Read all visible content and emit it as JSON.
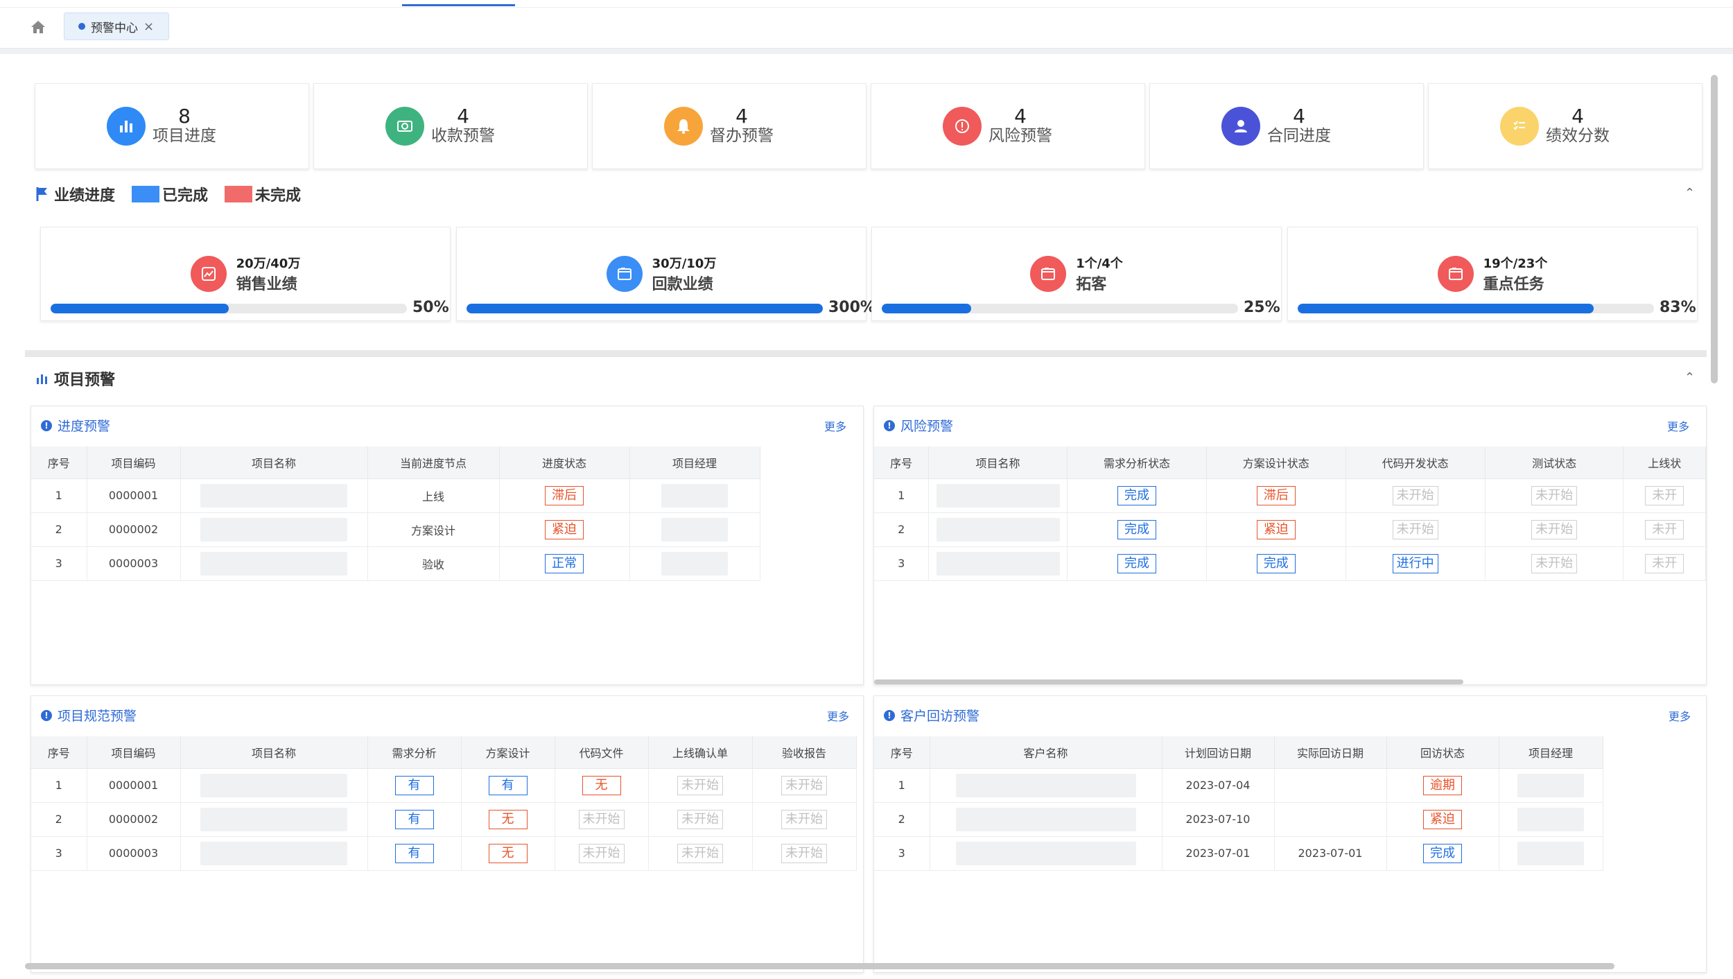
{
  "tabs": [
    {
      "label": "预警中心",
      "close": "×"
    }
  ],
  "stats": [
    {
      "num": "8",
      "label": "项目进度",
      "color": "#2f8af5",
      "icon": "bar-chart-icon"
    },
    {
      "num": "4",
      "label": "收款预警",
      "color": "#3fb37f",
      "icon": "money-icon"
    },
    {
      "num": "4",
      "label": "督办预警",
      "color": "#f7a53a",
      "icon": "bell-icon"
    },
    {
      "num": "4",
      "label": "风险预警",
      "color": "#f05a5a",
      "icon": "alert-icon"
    },
    {
      "num": "4",
      "label": "合同进度",
      "color": "#4a53d8",
      "icon": "user-icon"
    },
    {
      "num": "4",
      "label": "绩效分数",
      "color": "#fad46a",
      "icon": "checklist-icon"
    }
  ],
  "performance": {
    "title": "业绩进度",
    "legend": [
      {
        "label": "已完成",
        "color": "#3a8ef5"
      },
      {
        "label": "未完成",
        "color": "#f26b6b"
      }
    ],
    "collapse": "⌃",
    "cards": [
      {
        "value": "20万/40万",
        "label": "销售业绩",
        "pct": "50%",
        "fill": 0.5,
        "color": "#f05a5a"
      },
      {
        "value": "30万/10万",
        "label": "回款业绩",
        "pct": "300%",
        "fill": 1.0,
        "color": "#3a8ef5"
      },
      {
        "value": "1个/4个",
        "label": "拓客",
        "pct": "25%",
        "fill": 0.25,
        "color": "#f05a5a"
      },
      {
        "value": "19个/23个",
        "label": "重点任务",
        "pct": "83%",
        "fill": 0.83,
        "color": "#f05a5a"
      }
    ]
  },
  "project_warning": {
    "title": "项目预警",
    "collapse": "⌃"
  },
  "panels": {
    "progress": {
      "title": "进度预警",
      "more": "更多",
      "columns": [
        "序号",
        "项目编码",
        "项目名称",
        "当前进度节点",
        "进度状态",
        "项目经理"
      ],
      "rows": [
        {
          "no": "1",
          "code": "0000001",
          "node": "上线",
          "status": "滞后",
          "tone": "red"
        },
        {
          "no": "2",
          "code": "0000002",
          "node": "方案设计",
          "status": "紧迫",
          "tone": "red"
        },
        {
          "no": "3",
          "code": "0000003",
          "node": "验收",
          "status": "正常",
          "tone": "blue"
        }
      ]
    },
    "risk": {
      "title": "风险预警",
      "more": "更多",
      "columns": [
        "序号",
        "项目名称",
        "需求分析状态",
        "方案设计状态",
        "代码开发状态",
        "测试状态",
        "上线状"
      ],
      "rows": [
        {
          "no": "1",
          "cells": [
            [
              "完成",
              "blue"
            ],
            [
              "滞后",
              "red"
            ],
            [
              "未开始",
              "gray"
            ],
            [
              "未开始",
              "gray"
            ],
            [
              "未开",
              "gray"
            ]
          ]
        },
        {
          "no": "2",
          "cells": [
            [
              "完成",
              "blue"
            ],
            [
              "紧迫",
              "red"
            ],
            [
              "未开始",
              "gray"
            ],
            [
              "未开始",
              "gray"
            ],
            [
              "未开",
              "gray"
            ]
          ]
        },
        {
          "no": "3",
          "cells": [
            [
              "完成",
              "blue"
            ],
            [
              "完成",
              "blue"
            ],
            [
              "进行中",
              "blue"
            ],
            [
              "未开始",
              "gray"
            ],
            [
              "未开",
              "gray"
            ]
          ]
        }
      ]
    },
    "norm": {
      "title": "项目规范预警",
      "more": "更多",
      "columns": [
        "序号",
        "项目编码",
        "项目名称",
        "需求分析",
        "方案设计",
        "代码文件",
        "上线确认单",
        "验收报告"
      ],
      "rows": [
        {
          "no": "1",
          "code": "0000001",
          "cells": [
            [
              "有",
              "blue"
            ],
            [
              "有",
              "blue"
            ],
            [
              "无",
              "red"
            ],
            [
              "未开始",
              "gray"
            ],
            [
              "未开始",
              "gray"
            ]
          ]
        },
        {
          "no": "2",
          "code": "0000002",
          "cells": [
            [
              "有",
              "blue"
            ],
            [
              "无",
              "red"
            ],
            [
              "未开始",
              "gray"
            ],
            [
              "未开始",
              "gray"
            ],
            [
              "未开始",
              "gray"
            ]
          ]
        },
        {
          "no": "3",
          "code": "0000003",
          "cells": [
            [
              "有",
              "blue"
            ],
            [
              "无",
              "red"
            ],
            [
              "未开始",
              "gray"
            ],
            [
              "未开始",
              "gray"
            ],
            [
              "未开始",
              "gray"
            ]
          ]
        }
      ]
    },
    "visit": {
      "title": "客户回访预警",
      "more": "更多",
      "columns": [
        "序号",
        "客户名称",
        "计划回访日期",
        "实际回访日期",
        "回访状态",
        "项目经理"
      ],
      "rows": [
        {
          "no": "1",
          "plan": "2023-07-04",
          "actual": "",
          "status": "逾期",
          "tone": "red"
        },
        {
          "no": "2",
          "plan": "2023-07-10",
          "actual": "",
          "status": "紧迫",
          "tone": "red"
        },
        {
          "no": "3",
          "plan": "2023-07-01",
          "actual": "2023-07-01",
          "status": "完成",
          "tone": "blue"
        }
      ]
    }
  }
}
